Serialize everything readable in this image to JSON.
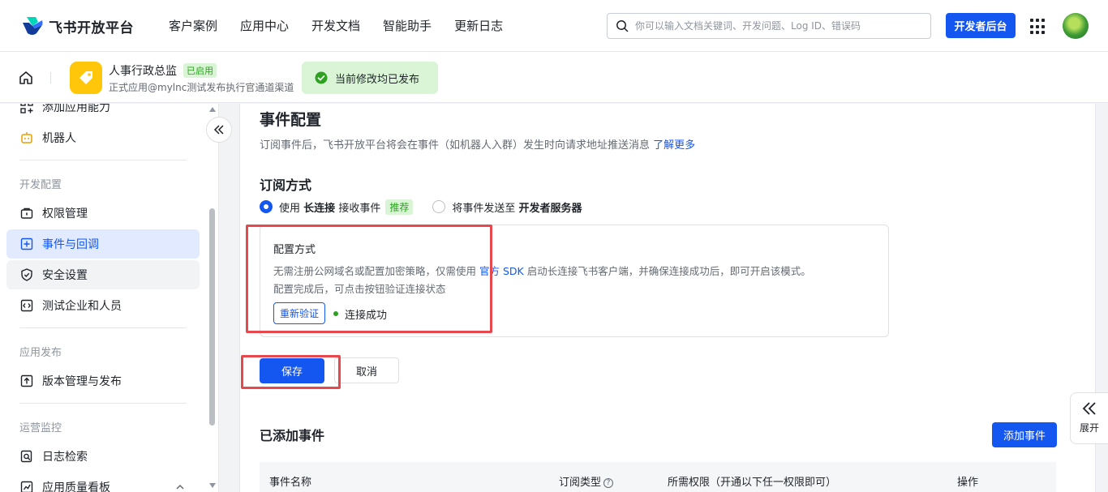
{
  "brand": {
    "name": "飞书开放平台"
  },
  "topnav": [
    {
      "label": "客户案例"
    },
    {
      "label": "应用中心"
    },
    {
      "label": "开发文档"
    },
    {
      "label": "智能助手"
    },
    {
      "label": "更新日志"
    }
  ],
  "search": {
    "placeholder": "你可以输入文档关键词、开发问题、Log ID、错误码",
    "value": ""
  },
  "header_actions": {
    "dev_console": "开发者后台"
  },
  "app": {
    "name": "人事行政总监",
    "status": "已启用",
    "subtitle": "正式应用@mylnc测试发布执行官通道渠道",
    "publish_toast": "当前修改均已发布"
  },
  "sidebar": {
    "items_top": [
      {
        "label": "添加应用能力",
        "icon": "add-capability-icon"
      },
      {
        "label": "机器人",
        "icon": "robot-icon"
      }
    ],
    "group_dev": "开发配置",
    "items_dev": [
      {
        "label": "权限管理",
        "icon": "permission-icon"
      },
      {
        "label": "事件与回调",
        "icon": "event-icon",
        "active": true
      },
      {
        "label": "安全设置",
        "icon": "shield-icon"
      },
      {
        "label": "测试企业和人员",
        "icon": "test-icon"
      }
    ],
    "group_publish": "应用发布",
    "items_publish": [
      {
        "label": "版本管理与发布",
        "icon": "upload-icon"
      }
    ],
    "group_monitor": "运营监控",
    "items_monitor": [
      {
        "label": "日志检索",
        "icon": "log-search-icon"
      },
      {
        "label": "应用质量看板",
        "icon": "dashboard-icon"
      }
    ]
  },
  "main": {
    "title": "事件配置",
    "description": "订阅事件后，飞书开放平台将会在事件（如机器人入群）发生时向请求地址推送消息",
    "learn_more": "了解更多",
    "subscribe_title": "订阅方式",
    "option_long": {
      "prefix": "使用",
      "bold": "长连接",
      "suffix": "接收事件",
      "tag": "推荐",
      "checked": true
    },
    "option_server": {
      "prefix": "将事件发送至",
      "bold": "开发者服务器",
      "checked": false
    },
    "config": {
      "title": "配置方式",
      "desc_part1": "无需注册公网域名或配置加密策略，仅需使用",
      "desc_link": "官方 SDK",
      "desc_part2": "启动长连接飞书客户端，并确保连接成功后，即可开启该模式。",
      "desc_line2": "配置完成后，可点击按钮验证连接状态",
      "verify_button": "重新验证",
      "status": "连接成功"
    },
    "save_button": "保存",
    "cancel_button": "取消",
    "added_title": "已添加事件",
    "add_button": "添加事件",
    "table_headers": [
      "事件名称",
      "订阅类型",
      "所需权限（开通以下任一权限即可）",
      "操作"
    ]
  },
  "expand_widget": {
    "label": "展开"
  },
  "colors": {
    "primary": "#1456f0",
    "success": "#2ea121",
    "highlight": "#e5484d"
  }
}
